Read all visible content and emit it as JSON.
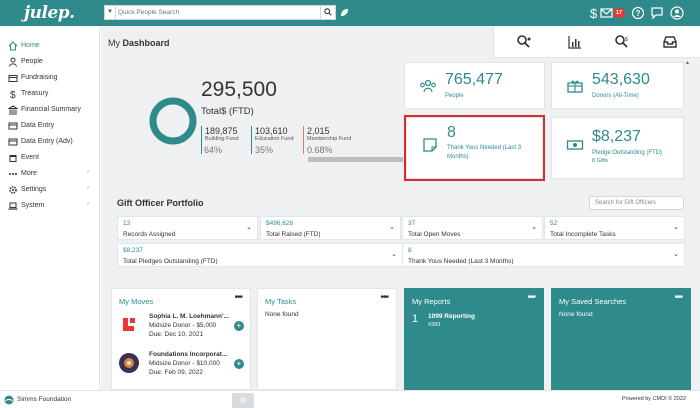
{
  "header": {
    "logo": "julep.",
    "search_placeholder": "Quick People Search",
    "notification_count": "17"
  },
  "sidebar": {
    "items": [
      {
        "label": "Home",
        "icon": "home-icon",
        "active": true,
        "chevron": false
      },
      {
        "label": "People",
        "icon": "person-icon",
        "active": false,
        "chevron": false
      },
      {
        "label": "Fundraising",
        "icon": "wallet-icon",
        "active": false,
        "chevron": false
      },
      {
        "label": "Treasury",
        "icon": "dollar-icon",
        "active": false,
        "chevron": false
      },
      {
        "label": "Financial Summary",
        "icon": "bank-icon",
        "active": false,
        "chevron": false
      },
      {
        "label": "Data Entry",
        "icon": "card-icon",
        "active": false,
        "chevron": false
      },
      {
        "label": "Data Entry (Adv)",
        "icon": "card-icon",
        "active": false,
        "chevron": false
      },
      {
        "label": "Event",
        "icon": "calendar-icon",
        "active": false,
        "chevron": false
      },
      {
        "label": "More",
        "icon": "ellipsis-icon",
        "active": false,
        "chevron": true
      },
      {
        "label": "Settings",
        "icon": "gear-icon",
        "active": false,
        "chevron": true
      },
      {
        "label": "System",
        "icon": "laptop-icon",
        "active": false,
        "chevron": true
      }
    ]
  },
  "dashboard": {
    "title_prefix": "My",
    "title_strong": "Dashboard",
    "total": "295,500",
    "total_label": "Total$ (FTD)",
    "funds": [
      {
        "amount": "189,875",
        "name": "Building Fund",
        "pct": "64%",
        "color": "#2f8a8c"
      },
      {
        "amount": "103,610",
        "name": "Education Fund",
        "pct": "35%",
        "color": "#2f8a8c"
      },
      {
        "amount": "2,015",
        "name": "Membership Fund",
        "pct": "0.68%",
        "color": "#e57373"
      }
    ],
    "progress_fraction": 0.64
  },
  "kpis": {
    "people": {
      "value": "765,477",
      "label": "People"
    },
    "donors": {
      "value": "543,630",
      "label": "Donors (All-Time)"
    },
    "thank_yous": {
      "value": "8",
      "label_line1": "Thank Yous Needed (Last 3",
      "label_line2": "Months)"
    },
    "pledge": {
      "value": "$8,237",
      "label": "Pledge Outstanding (FTD)",
      "sub": "8 Gifts"
    }
  },
  "portfolio": {
    "title": "Gift Officer Portfolio",
    "search_placeholder": "Search for Gift Officers",
    "stats": [
      {
        "value": "13",
        "label": "Records Assigned"
      },
      {
        "value": "$496,626",
        "label": "Total Raised (FTD)"
      },
      {
        "value": "37",
        "label": "Total Open Moves"
      },
      {
        "value": "52",
        "label": "Total Incomplete Tasks"
      },
      {
        "value": "$8,237",
        "label": "Total Pledges Outstanding (FTD)"
      },
      {
        "value": "8",
        "label": "Thank Yous Needed (Last 3 Months)"
      }
    ]
  },
  "cards": {
    "moves": {
      "title": "My Moves",
      "items": [
        {
          "name": "Sophia L. M. Loehmann'...",
          "desc": "Midsize Donor - $5,000",
          "due": "Due: Dec 10, 2021"
        },
        {
          "name": "Foundations Incorporat...",
          "desc": "Midsize Donor - $10,000",
          "due": "Due: Feb 09, 2022"
        }
      ]
    },
    "tasks": {
      "title": "My Tasks",
      "empty": "None found"
    },
    "reports": {
      "title": "My Reports",
      "num": "1",
      "name": "1099 Reporting",
      "id": "#393"
    },
    "saved": {
      "title": "My Saved Searches",
      "empty": "None found"
    }
  },
  "footer": {
    "org": "Simms Foundation",
    "powered": "Powered by CMDI © 2022"
  }
}
